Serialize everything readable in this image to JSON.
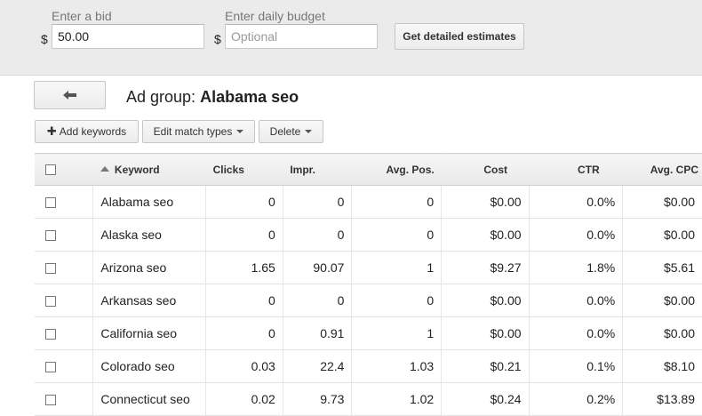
{
  "bid": {
    "label": "Enter a bid",
    "currency": "$",
    "value": "50.00"
  },
  "budget": {
    "label": "Enter daily budget",
    "currency": "$",
    "placeholder": "Optional"
  },
  "estimates_button": "Get detailed estimates",
  "back_icon": "arrow-left-icon",
  "ad_group": {
    "prefix": "Ad group:",
    "name": "Alabama seo"
  },
  "toolbar": {
    "add_keywords": "Add keywords",
    "edit_match_types": "Edit match types",
    "delete": "Delete"
  },
  "table": {
    "headers": {
      "keyword": "Keyword",
      "clicks": "Clicks",
      "impr": "Impr.",
      "avg_pos": "Avg. Pos.",
      "cost": "Cost",
      "ctr": "CTR",
      "avg_cpc": "Avg. CPC"
    },
    "sort": "keyword-ascending",
    "rows": [
      {
        "keyword": "Alabama seo",
        "clicks": "0",
        "impr": "0",
        "avg_pos": "0",
        "cost": "$0.00",
        "ctr": "0.0%",
        "avg_cpc": "$0.00"
      },
      {
        "keyword": "Alaska seo",
        "clicks": "0",
        "impr": "0",
        "avg_pos": "0",
        "cost": "$0.00",
        "ctr": "0.0%",
        "avg_cpc": "$0.00"
      },
      {
        "keyword": "Arizona seo",
        "clicks": "1.65",
        "impr": "90.07",
        "avg_pos": "1",
        "cost": "$9.27",
        "ctr": "1.8%",
        "avg_cpc": "$5.61"
      },
      {
        "keyword": "Arkansas seo",
        "clicks": "0",
        "impr": "0",
        "avg_pos": "0",
        "cost": "$0.00",
        "ctr": "0.0%",
        "avg_cpc": "$0.00"
      },
      {
        "keyword": "California seo",
        "clicks": "0",
        "impr": "0.91",
        "avg_pos": "1",
        "cost": "$0.00",
        "ctr": "0.0%",
        "avg_cpc": "$0.00"
      },
      {
        "keyword": "Colorado seo",
        "clicks": "0.03",
        "impr": "22.4",
        "avg_pos": "1.03",
        "cost": "$0.21",
        "ctr": "0.1%",
        "avg_cpc": "$8.10"
      },
      {
        "keyword": "Connecticut seo",
        "clicks": "0.02",
        "impr": "9.73",
        "avg_pos": "1.02",
        "cost": "$0.24",
        "ctr": "0.2%",
        "avg_cpc": "$13.89"
      }
    ]
  }
}
